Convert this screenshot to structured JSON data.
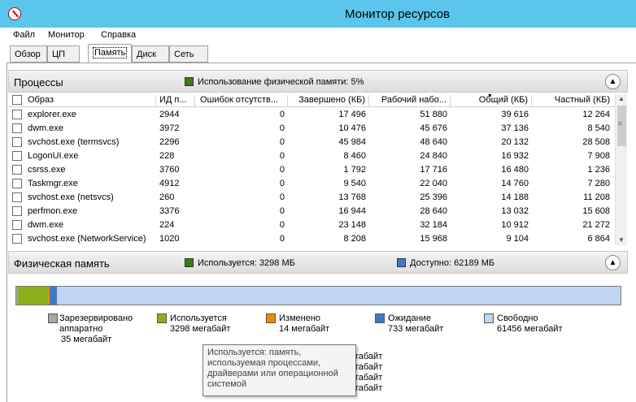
{
  "window": {
    "title": "Монитор ресурсов"
  },
  "menu": [
    "Файл",
    "Монитор",
    "Справка"
  ],
  "tabs": [
    "Обзор",
    "ЦП",
    "Память",
    "Диск",
    "Сеть"
  ],
  "processes": {
    "title": "Процессы",
    "usage_label": "Использование физической памяти: 5%",
    "columns": [
      "Образ",
      "ИД п...",
      "Ошибок отсутств...",
      "Завершено (КБ)",
      "Рабочий набо...",
      "Общий (КБ)",
      "Частный (КБ)"
    ],
    "rows": [
      [
        "explorer.exe",
        "2944",
        "0",
        "17 496",
        "51 880",
        "39 616",
        "12 264"
      ],
      [
        "dwm.exe",
        "3972",
        "0",
        "10 476",
        "45 676",
        "37 136",
        "8 540"
      ],
      [
        "svchost.exe (termsvcs)",
        "2296",
        "0",
        "45 984",
        "48 640",
        "20 132",
        "28 508"
      ],
      [
        "LogonUI.exe",
        "228",
        "0",
        "8 460",
        "24 840",
        "16 932",
        "7 908"
      ],
      [
        "csrss.exe",
        "3760",
        "0",
        "1 792",
        "17 716",
        "16 480",
        "1 236"
      ],
      [
        "Taskmgr.exe",
        "4912",
        "0",
        "9 540",
        "22 040",
        "14 760",
        "7 280"
      ],
      [
        "svchost.exe (netsvcs)",
        "260",
        "0",
        "13 768",
        "25 396",
        "14 188",
        "11 208"
      ],
      [
        "perfmon.exe",
        "3376",
        "0",
        "16 944",
        "28 640",
        "13 032",
        "15 608"
      ],
      [
        "dwm.exe",
        "224",
        "0",
        "23 148",
        "32 184",
        "10 912",
        "21 272"
      ],
      [
        "svchost.exe (NetworkService)",
        "1020",
        "0",
        "8 208",
        "15 968",
        "9 104",
        "6 864"
      ]
    ]
  },
  "physical_memory": {
    "title": "Физическая память",
    "used_label": "Используется: 3298 МБ",
    "available_label": "Доступно: 62189 МБ",
    "bar": [
      {
        "name": "reserved",
        "mb": 35,
        "color": "#a8a8a8"
      },
      {
        "name": "used",
        "mb": 3298,
        "color": "#8cb01b"
      },
      {
        "name": "modified",
        "mb": 14,
        "color": "#f08a00"
      },
      {
        "name": "standby",
        "mb": 733,
        "color": "#3f78c8"
      },
      {
        "name": "free",
        "mb": 61456,
        "color": "#bfd6f0"
      }
    ],
    "legend": [
      {
        "line1": "Зарезервировано",
        "line2": "аппаратно",
        "line3": "35 мегабайт",
        "color": "#a8a8a8"
      },
      {
        "line1": "Используется",
        "line2": "3298 мегабайт",
        "color": "#8cb01b"
      },
      {
        "line1": "Изменено",
        "line2": "14 мегабайт",
        "color": "#f08a00"
      },
      {
        "line1": "Ожидание",
        "line2": "733 мегабайт",
        "color": "#3f78c8"
      },
      {
        "line1": "Свободно",
        "line2": "61456 мегабайт",
        "color": "#bfd6f0"
      }
    ],
    "behind_tooltip": [
      "габайт",
      "габайт",
      "габайт",
      "габайт"
    ],
    "tooltip": "Используется: память, используемая процессами, драйверами или операционной системой"
  },
  "colors": {
    "titlebar": "#5bc6ec",
    "used": "#8cb01b",
    "available": "#3f78c8"
  }
}
